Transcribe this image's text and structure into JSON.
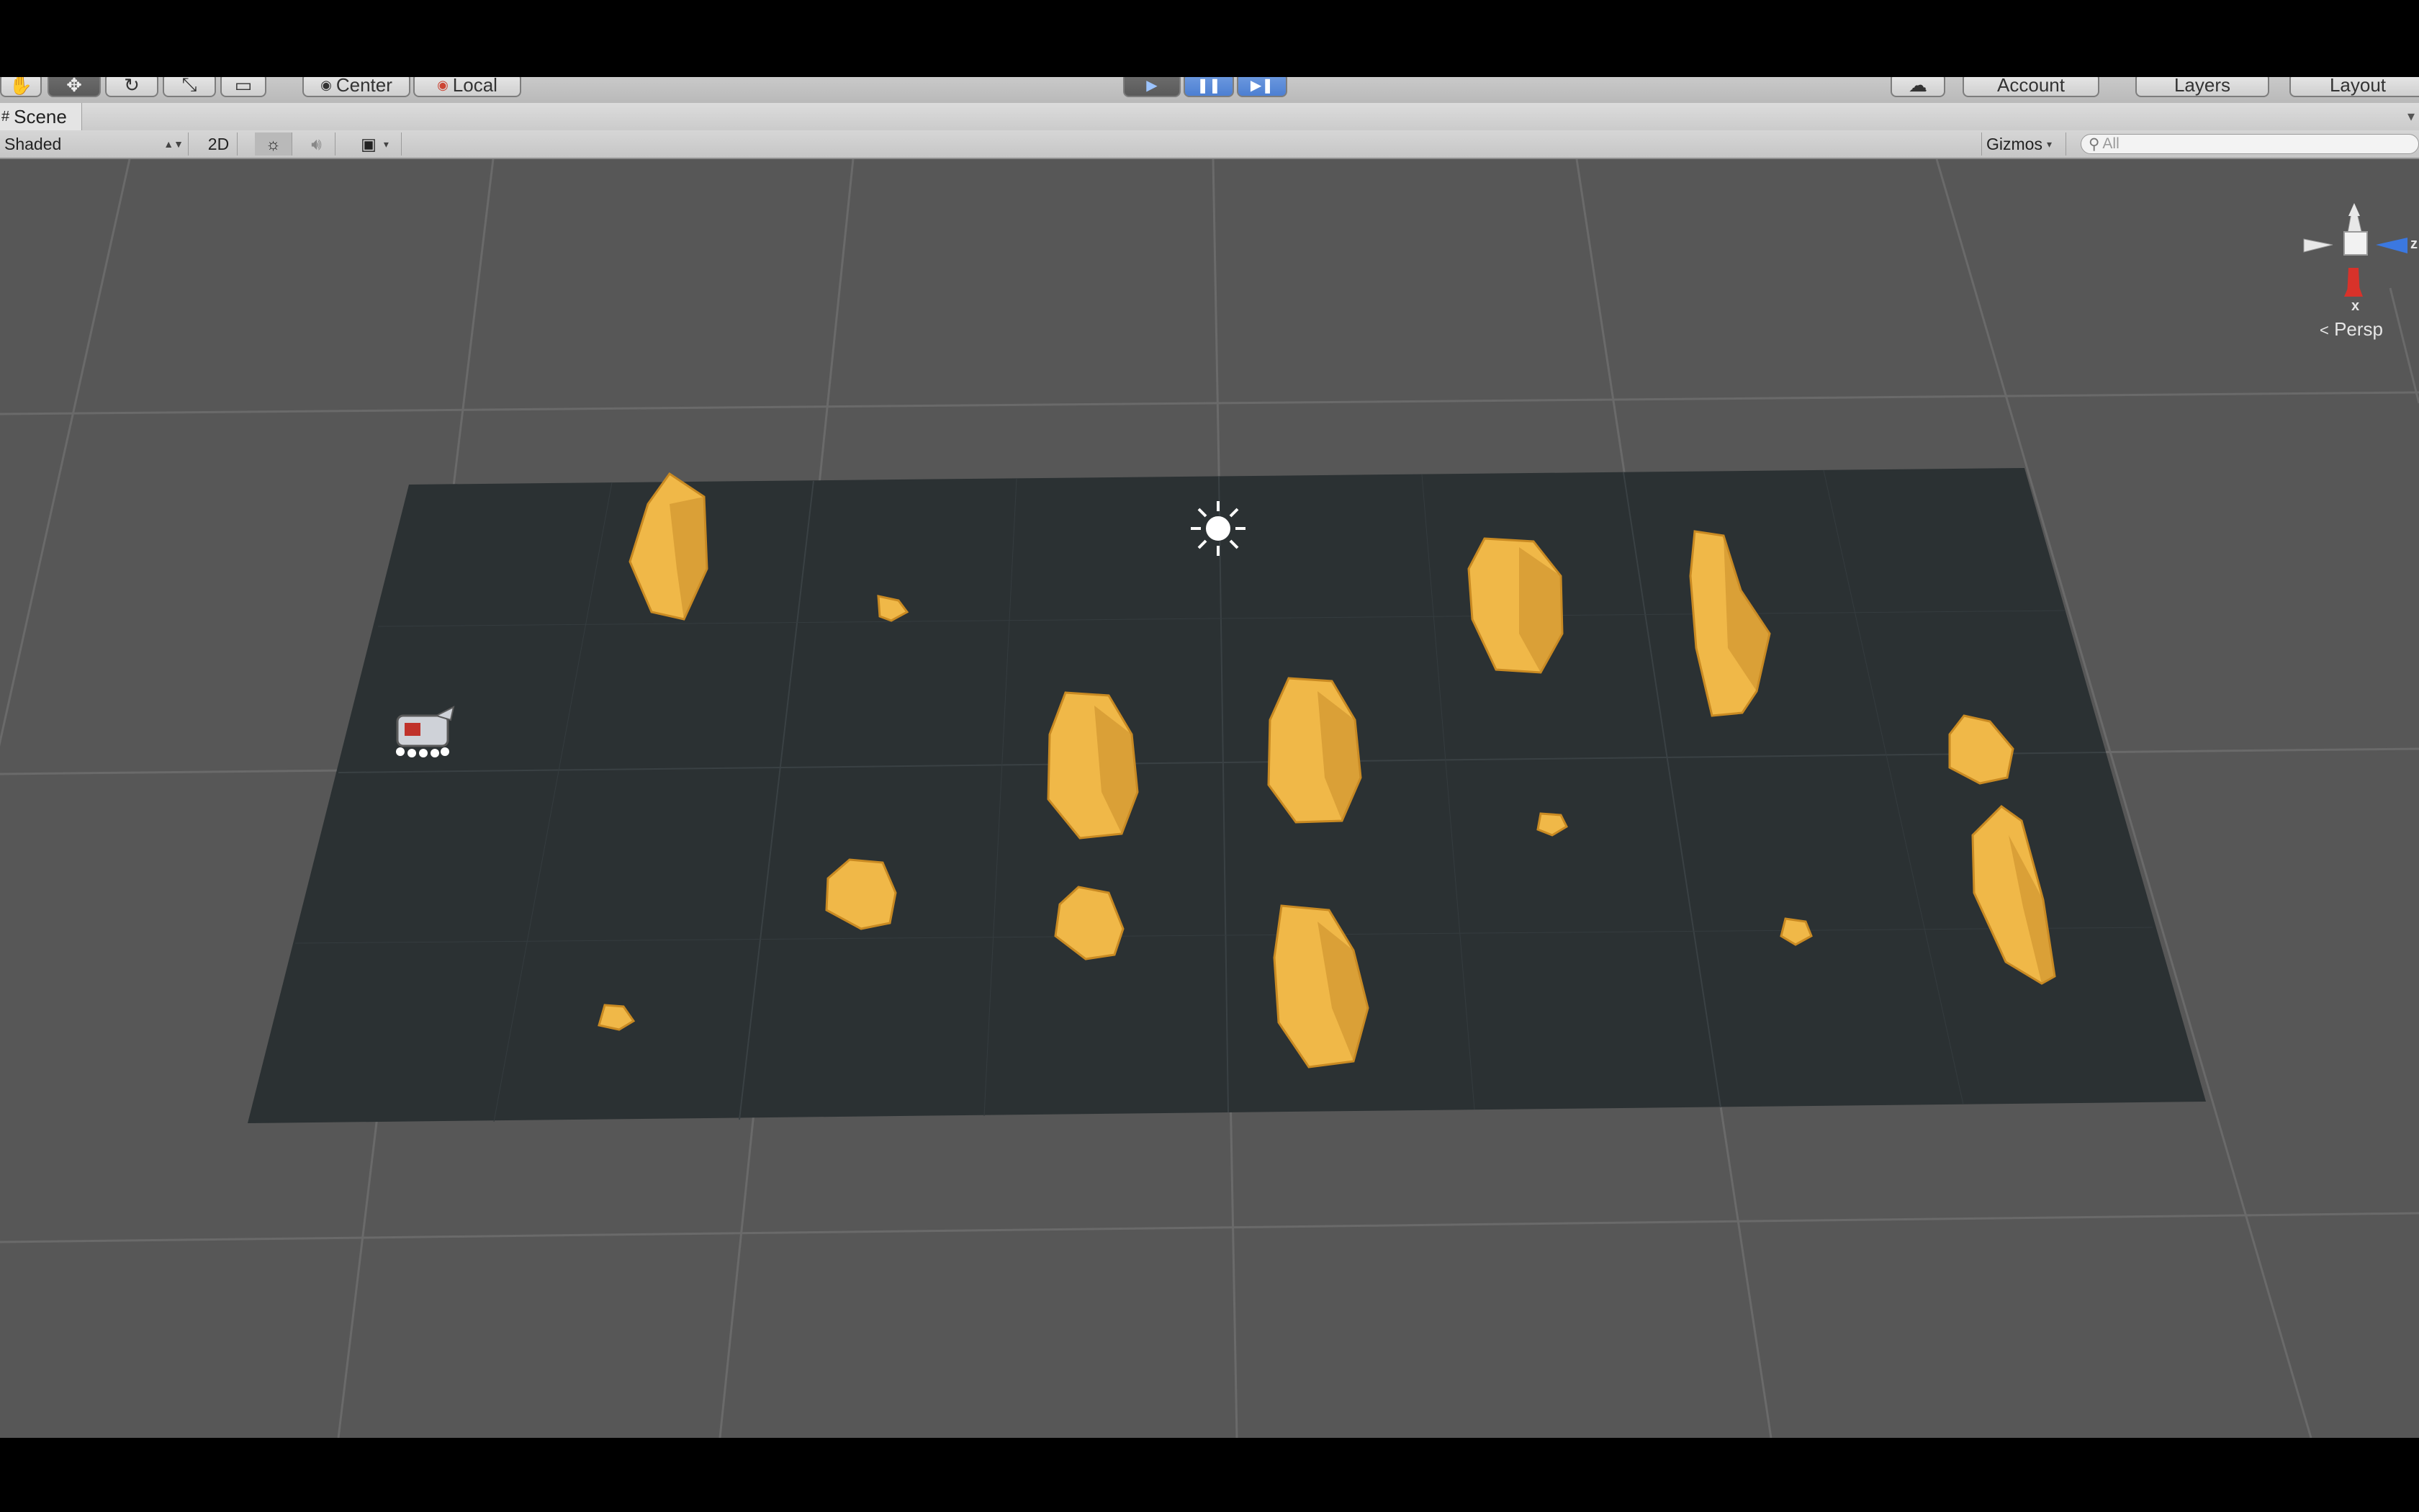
{
  "toolbar": {
    "pivot_label": "Center",
    "space_label": "Local",
    "account_label": "Account",
    "layers_label": "Layers",
    "layout_label": "Layout"
  },
  "scene_tab": {
    "label": "Scene"
  },
  "scene_toolbar": {
    "draw_mode": "Shaded",
    "mode_2d": "2D",
    "gizmos_label": "Gizmos",
    "search_placeholder": "All"
  },
  "viewport": {
    "projection_label": "Persp",
    "gizmo_axis_label": "x",
    "gizmo_axis_z": "z",
    "plane_color": "#2b3133",
    "background_color": "#575757",
    "rock_color": "#f0b848",
    "icons": [
      "sun-light-icon",
      "player-ship-icon",
      "orientation-gizmo"
    ]
  },
  "colors": {
    "play_accent": "#4c7fd2",
    "gizmo_red": "#d8322a",
    "gizmo_blue": "#3b78e0"
  }
}
